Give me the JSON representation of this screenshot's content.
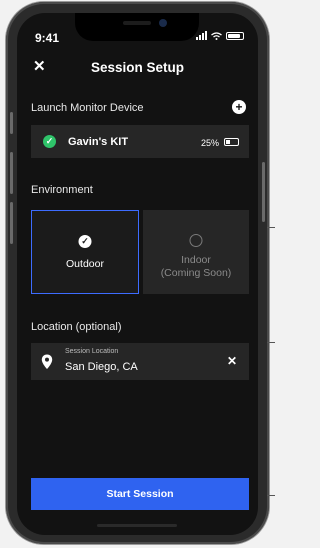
{
  "status_bar": {
    "time": "9:41"
  },
  "header": {
    "title": "Session Setup",
    "close_icon": "close-icon"
  },
  "launch_monitor": {
    "section_label": "Launch Monitor Device",
    "add_icon": "plus-circle-icon",
    "device": {
      "name": "Gavin's KIT",
      "battery_percent": "25%",
      "status": "connected"
    }
  },
  "environment": {
    "section_label": "Environment",
    "options": [
      {
        "label": "Outdoor",
        "selected": true
      },
      {
        "label": "Indoor",
        "sublabel": "(Coming Soon)",
        "selected": false
      }
    ]
  },
  "location": {
    "section_label": "Location (optional)",
    "caption": "Session Location",
    "value": "San Diego, CA",
    "pin_icon": "map-pin-icon",
    "clear_icon": "close-icon"
  },
  "actions": {
    "start_label": "Start Session"
  },
  "colors": {
    "accent": "#2f63f0",
    "success": "#2fc46a",
    "background": "#121212",
    "card": "#262626"
  }
}
